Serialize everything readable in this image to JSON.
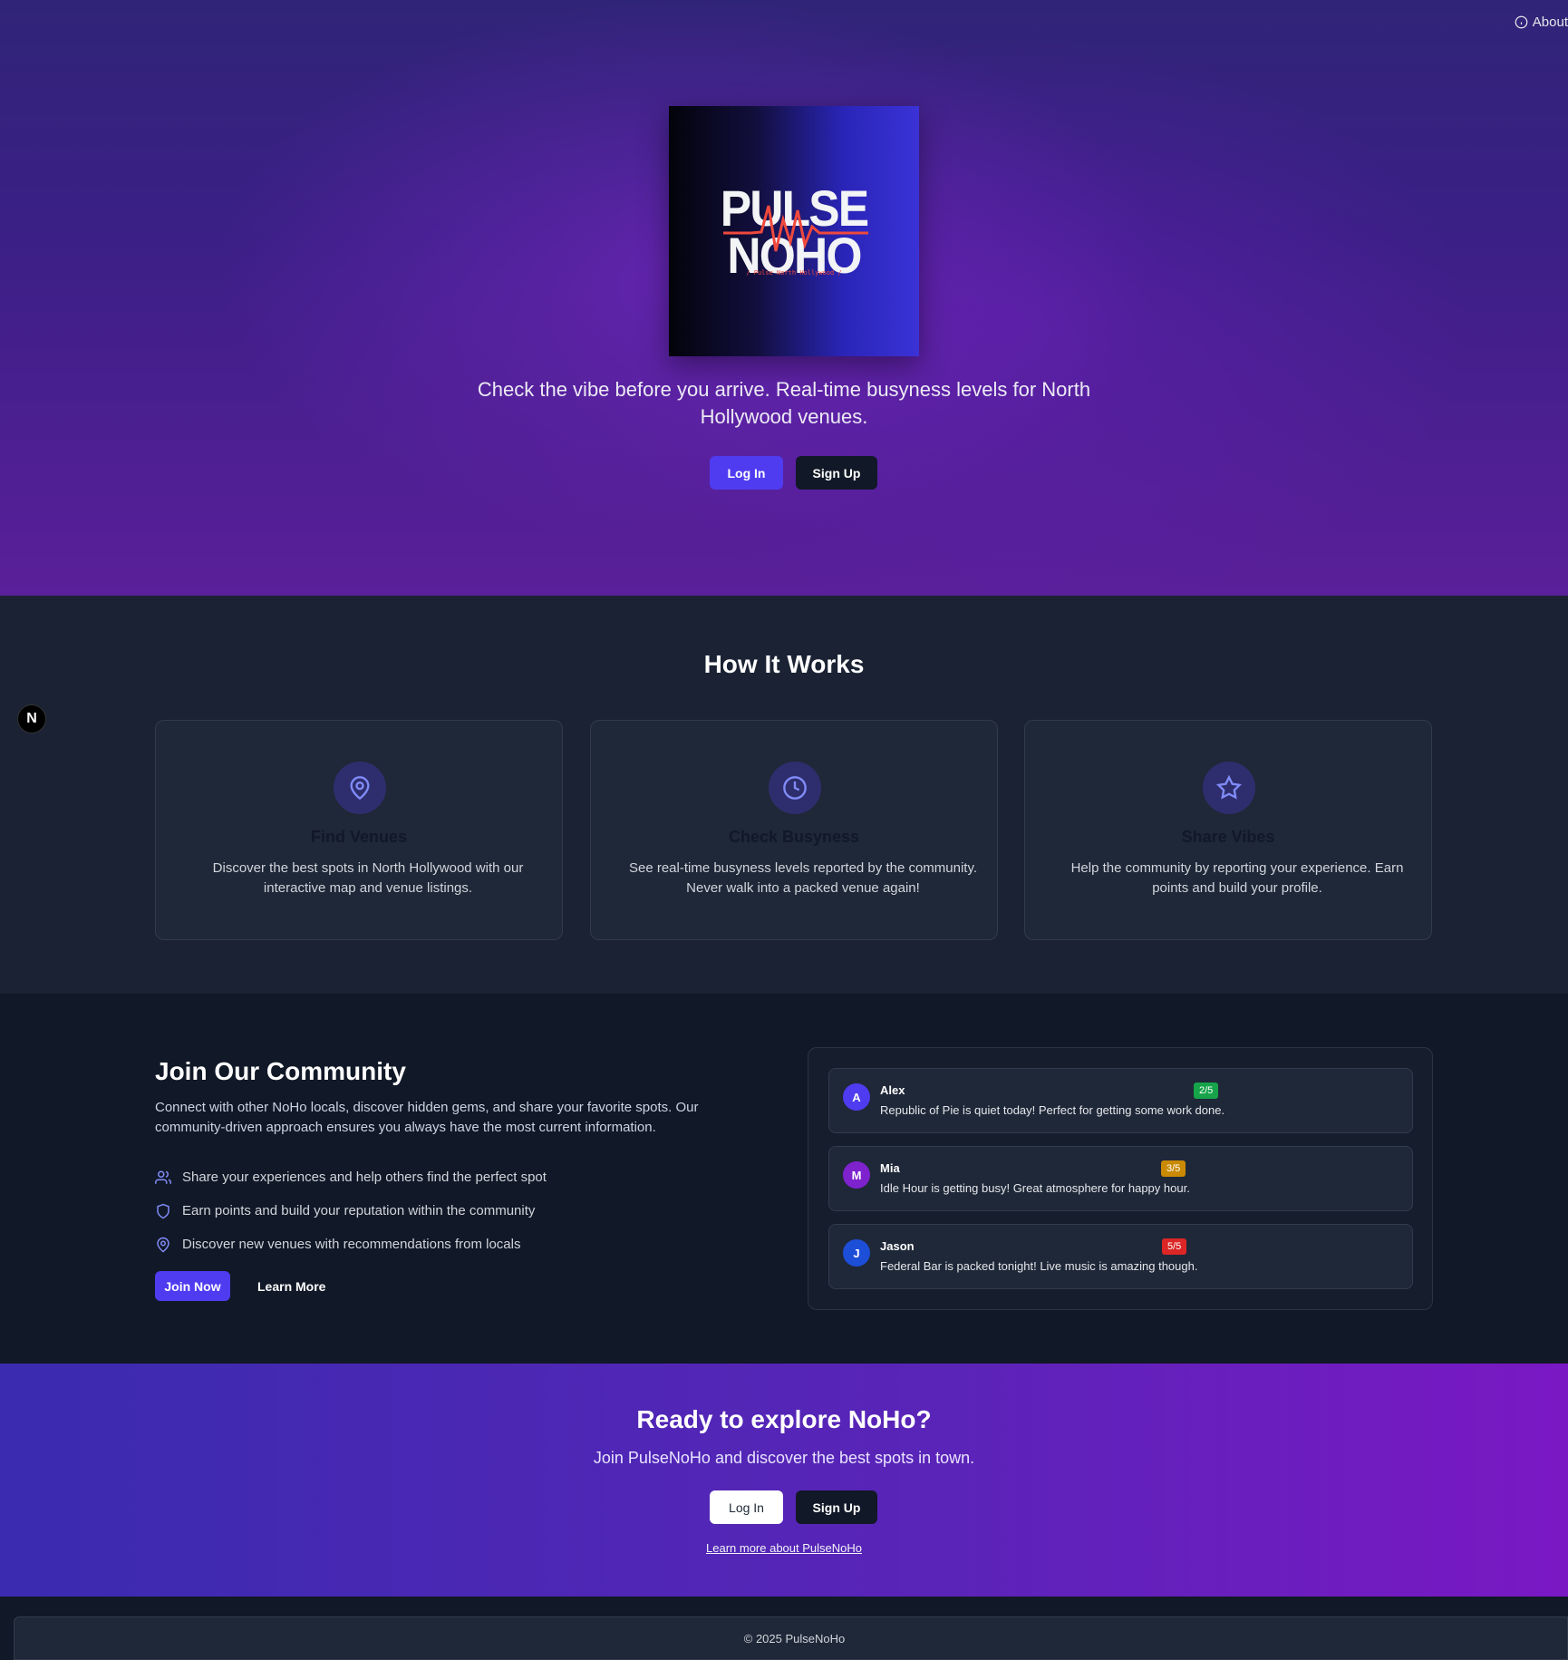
{
  "header": {
    "about_label": "About"
  },
  "hero": {
    "logo_line1": "PULSE",
    "logo_line2": "NOHO",
    "logo_tagline": "/ Pulse North Hollywood /",
    "tagline": "Check the vibe before you arrive. Real-time busyness levels for North Hollywood venues.",
    "login_label": "Log In",
    "signup_label": "Sign Up"
  },
  "how": {
    "title": "How It Works",
    "cards": [
      {
        "icon": "map-pin-icon",
        "title": "Find Venues",
        "desc": "Discover the best spots in North Hollywood with our interactive map and venue listings."
      },
      {
        "icon": "clock-icon",
        "title": "Check Busyness",
        "desc": "See real-time busyness levels reported by the community. Never walk into a packed venue again!"
      },
      {
        "icon": "star-icon",
        "title": "Share Vibes",
        "desc": "Help the community by reporting your experience. Earn points and build your profile."
      }
    ]
  },
  "dev_badge": "N",
  "community": {
    "title": "Join Our Community",
    "desc": "Connect with other NoHo locals, discover hidden gems, and share your favorite spots. Our community-driven approach ensures you always have the most current information.",
    "items": [
      {
        "icon": "users-icon",
        "text": "Share your experiences and help others find the perfect spot"
      },
      {
        "icon": "shield-icon",
        "text": "Earn points and build your reputation within the community"
      },
      {
        "icon": "map-pin-icon",
        "text": "Discover new venues with recommendations from locals"
      }
    ],
    "join_label": "Join Now",
    "learn_label": "Learn More",
    "posts": [
      {
        "initial": "A",
        "name": "Alex",
        "rating": "2/5",
        "text": "Republic of Pie is quiet today! Perfect for getting some work done.",
        "avatar_color": "#4f3cf0",
        "badge_color": "#16a34a"
      },
      {
        "initial": "M",
        "name": "Mia",
        "rating": "3/5",
        "text": "Idle Hour is getting busy! Great atmosphere for happy hour.",
        "avatar_color": "#7e22ce",
        "badge_color": "#ca8a04"
      },
      {
        "initial": "J",
        "name": "Jason",
        "rating": "5/5",
        "text": "Federal Bar is packed tonight! Live music is amazing though.",
        "avatar_color": "#1d4ed8",
        "badge_color": "#dc2626"
      }
    ]
  },
  "cta": {
    "title": "Ready to explore NoHo?",
    "subtitle": "Join PulseNoHo and discover the best spots in town.",
    "login_label": "Log In",
    "signup_label": "Sign Up",
    "learn_link": "Learn more about PulseNoHo"
  },
  "footer": {
    "copyright": "© 2025 PulseNoHo"
  },
  "colors": {
    "accent": "#4f3cf0",
    "dark": "#111827",
    "card": "#1f2838"
  }
}
